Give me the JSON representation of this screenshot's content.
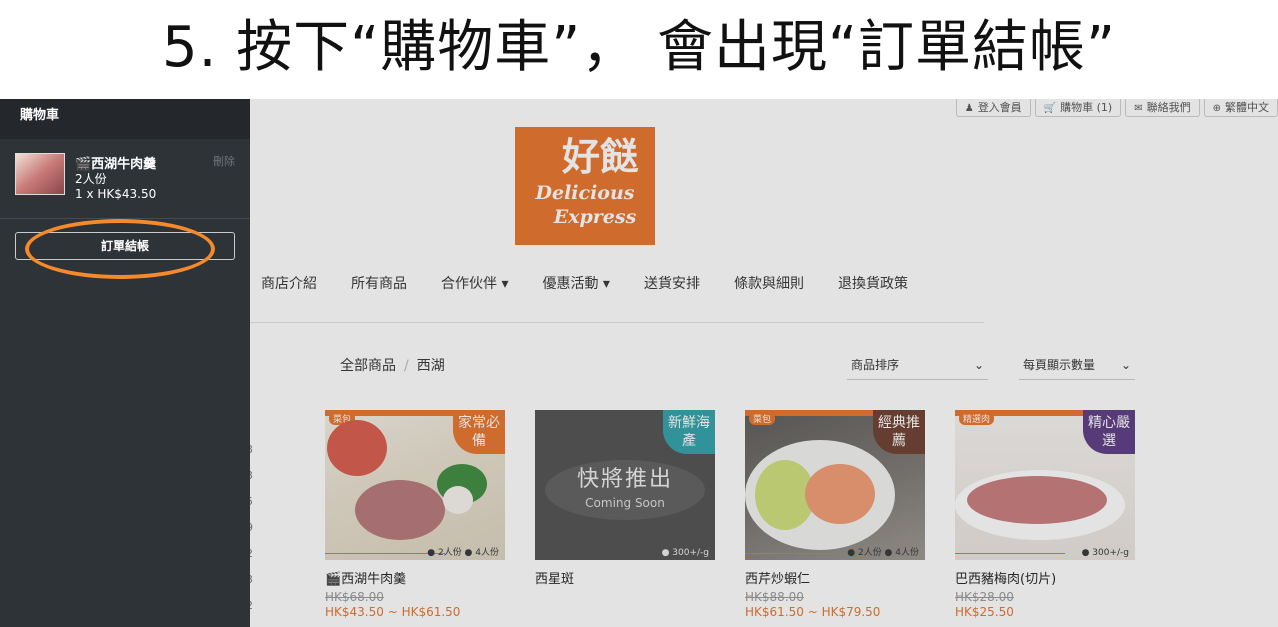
{
  "caption": {
    "text": "5. 按下“購物車”， 會出現“訂單結帳”"
  },
  "topbar": {
    "items": [
      {
        "icon": "user-icon",
        "label": "登入會員"
      },
      {
        "icon": "cart-icon",
        "label": "購物車 (1)"
      },
      {
        "icon": "chat-icon",
        "label": "聯絡我們"
      },
      {
        "icon": "globe-icon",
        "label": "繁體中文"
      }
    ]
  },
  "logo": {
    "cn": "好餸",
    "en_line1": "Delicious",
    "en_line2": "Express"
  },
  "nav": {
    "items": [
      "商店介紹",
      "所有商品",
      "合作伙伴 ▾",
      "優惠活動 ▾",
      "送貨安排",
      "條款與細則",
      "退換貨政策"
    ]
  },
  "breadcrumb": {
    "root": "全部商品",
    "current": "西湖"
  },
  "sort": {
    "order_label": "商品排序",
    "per_page_label": "每頁顯示數量"
  },
  "products": [
    {
      "name": "🎬西湖牛肉羹",
      "old_price": "HK$68.00",
      "price": "HK$43.50 ~ HK$61.50",
      "tag": "家常必備",
      "spec": "● 2人份 ● 4人份",
      "brand": "菜包"
    },
    {
      "name": "西星斑",
      "old_price": "",
      "price": "",
      "tag": "新鮮海產",
      "spec": "● 300+/-g",
      "coming": "快將推出",
      "coming_en": "Coming Soon"
    },
    {
      "name": "西芹炒蝦仁",
      "old_price": "HK$88.00",
      "price": "HK$61.50 ~ HK$79.50",
      "tag": "經典推薦",
      "spec": "● 2人份 ● 4人份",
      "brand": "菜包"
    },
    {
      "name": "巴西豬梅肉(切片)",
      "old_price": "HK$28.00",
      "price": "HK$25.50",
      "tag": "精心嚴選",
      "spec": "● 300+/-g",
      "brand": "精選肉"
    }
  ],
  "cart_panel": {
    "title": "購物車",
    "item": {
      "name": "🎬西湖牛肉羹",
      "variant": "2人份",
      "qty_price": "1 x  HK$43.50",
      "delete_label": "刪除"
    },
    "checkout_label": "訂單結帳"
  },
  "colors": {
    "brand_orange": "#e8732a",
    "panel_bg": "#2e3338",
    "highlight": "#f48a2c"
  }
}
